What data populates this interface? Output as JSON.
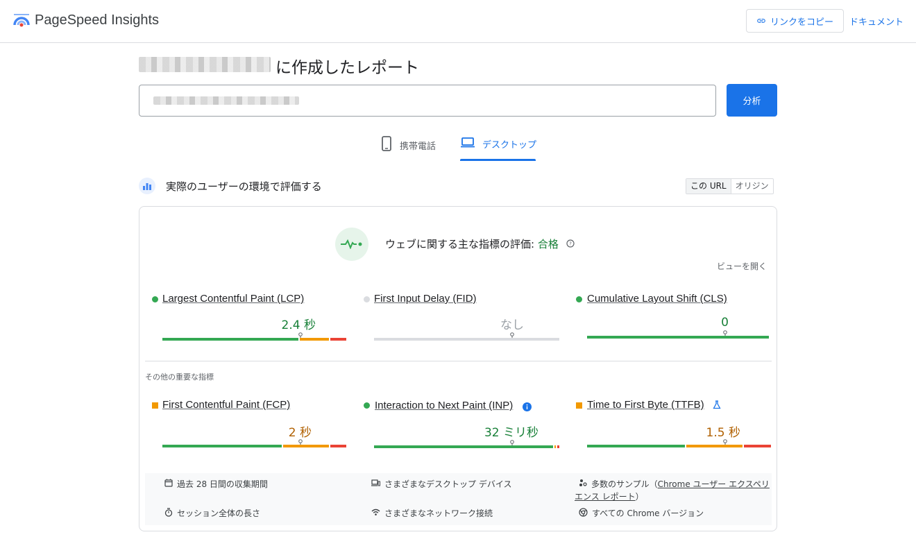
{
  "header": {
    "brand": "PageSpeed Insights",
    "copy_link": "リンクをコピー",
    "docs": "ドキュメント"
  },
  "report": {
    "title_suffix": "に作成したレポート",
    "analyze": "分析"
  },
  "tabs": [
    {
      "label": "携帯電話",
      "icon": "smartphone-icon",
      "selected": false
    },
    {
      "label": "デスクトップ",
      "icon": "laptop-icon",
      "selected": true
    }
  ],
  "field": {
    "title": "実際のユーザーの環境で評価する",
    "toggle": {
      "this_url": "この URL",
      "origin": "オリジン",
      "active": "この URL"
    },
    "assessment_prefix": "ウェブに関する主な指標の評価: ",
    "assessment_result": "合格",
    "expand": "ビューを開く",
    "other_label": "その他の重要な指標",
    "metrics": [
      {
        "id": "lcp",
        "label": "Largest Contentful Paint (LCP)",
        "value": "2.4 秒",
        "status": "good",
        "dist": [
          75,
          16,
          9
        ]
      },
      {
        "id": "fid",
        "label": "First Input Delay (FID)",
        "value": "なし",
        "status": "none",
        "dist": [
          100,
          0,
          0
        ]
      },
      {
        "id": "cls",
        "label": "Cumulative Layout Shift (CLS)",
        "value": "0",
        "status": "good",
        "dist": [
          100,
          0,
          0
        ]
      },
      {
        "id": "fcp",
        "label": "First Contentful Paint (FCP)",
        "value": "2 秒",
        "status": "needs-improvement",
        "dist": [
          66,
          25,
          9
        ]
      },
      {
        "id": "inp",
        "label": "Interaction to Next Paint (INP)",
        "value": "32 ミリ秒",
        "status": "good",
        "dist": [
          98,
          1,
          1
        ]
      },
      {
        "id": "ttfb",
        "label": "Time to First Byte (TTFB)",
        "value": "1.5 秒",
        "status": "needs-improvement",
        "dist": [
          54,
          31,
          15
        ]
      }
    ],
    "info": {
      "period": "過去 28 日間の収集期間",
      "devices": "さまざまなデスクトップ デバイス",
      "samples_prefix": "多数のサンプル（",
      "samples_link_1": "Chrome ユーザー エクスペリ",
      "samples_link_2": "エンス レポート",
      "samples_suffix": "）",
      "session": "セッション全体の長さ",
      "network": "さまざまなネットワーク接続",
      "chrome": "すべての Chrome バージョン"
    }
  },
  "colors": {
    "good": "#34a853",
    "average": "#f29900",
    "poor": "#ea4335",
    "accent": "#1a73e8",
    "pass_text": "#188038",
    "average_text": "#b06000"
  }
}
